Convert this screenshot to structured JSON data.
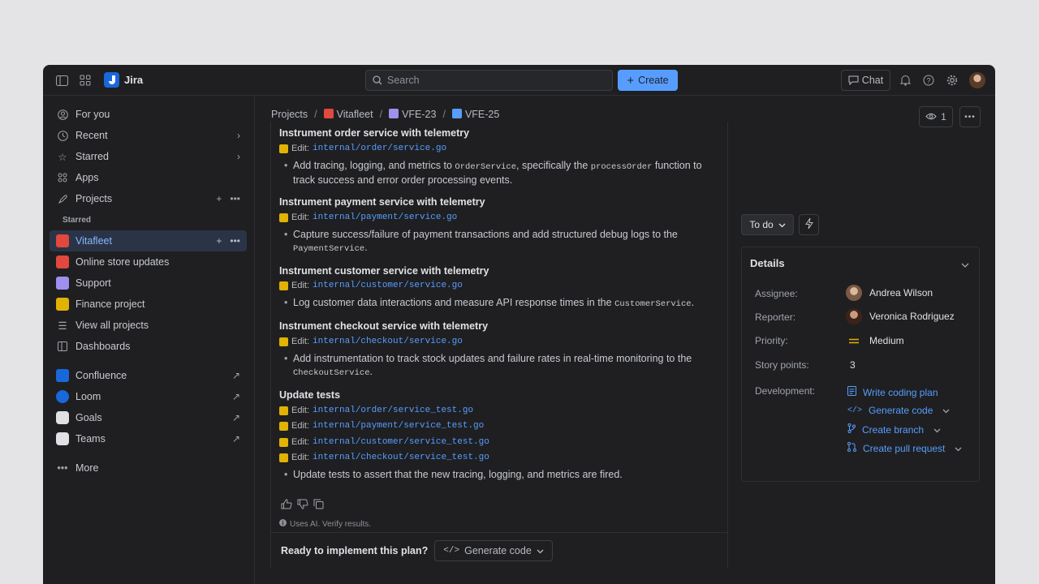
{
  "topbar": {
    "app_name": "Jira",
    "search_placeholder": "Search",
    "create_label": "Create",
    "chat_label": "Chat"
  },
  "sidebar": {
    "for_you": "For you",
    "recent": "Recent",
    "starred": "Starred",
    "apps": "Apps",
    "projects": "Projects",
    "starred_section": "Starred",
    "projects_list": [
      {
        "label": "Vitafleet",
        "color": "#e2483d"
      },
      {
        "label": "Online store updates",
        "color": "#e2483d"
      },
      {
        "label": "Support",
        "color": "#9f8fef"
      },
      {
        "label": "Finance project",
        "color": "#e2b203"
      }
    ],
    "view_all": "View all projects",
    "dashboards": "Dashboards",
    "external": [
      {
        "label": "Confluence"
      },
      {
        "label": "Loom"
      },
      {
        "label": "Goals"
      },
      {
        "label": "Teams"
      }
    ],
    "more": "More"
  },
  "breadcrumb": {
    "projects": "Projects",
    "project": "Vitafleet",
    "epic": "VFE-23",
    "issue": "VFE-25"
  },
  "plan": {
    "sections": [
      {
        "title": "Instrument order service with telemetry",
        "edits": [
          "internal/order/service.go"
        ],
        "bullet_pre": "Add tracing, logging, and metrics to ",
        "bullet_code": "OrderService",
        "bullet_mid": ", specifically the ",
        "bullet_code2": "processOrder",
        "bullet_post": " function to track success and error order processing events."
      },
      {
        "title": "Instrument payment service with telemetry",
        "edits": [
          "internal/payment/service.go"
        ],
        "bullet_pre": "Capture success/failure of payment transactions and add structured debug logs to the ",
        "bullet_code": "PaymentService",
        "bullet_post": "."
      },
      {
        "title": "Instrument customer service with telemetry",
        "edits": [
          "internal/customer/service.go"
        ],
        "bullet_pre": "Log customer data interactions and measure API response times in the ",
        "bullet_code": "CustomerService",
        "bullet_post": "."
      },
      {
        "title": "Instrument checkout service with telemetry",
        "edits": [
          "internal/checkout/service.go"
        ],
        "bullet_pre": "Add instrumentation to track stock updates and failure rates in real-time monitoring to the ",
        "bullet_code": "CheckoutService",
        "bullet_post": "."
      },
      {
        "title": "Update tests",
        "edits": [
          "internal/order/service_test.go",
          "internal/payment/service_test.go",
          "internal/customer/service_test.go",
          "internal/checkout/service_test.go"
        ],
        "bullet_pre": "Update tests to assert that the new tracing, logging, and metrics are fired."
      }
    ],
    "edit_prefix": "Edit:",
    "disclaimer": "Uses AI. Verify results.",
    "ready_question": "Ready to implement this plan?",
    "generate_code": "Generate code"
  },
  "issue_panel": {
    "watchers": "1",
    "status": "To do",
    "details_title": "Details",
    "assignee_label": "Assignee:",
    "assignee": "Andrea Wilson",
    "reporter_label": "Reporter:",
    "reporter": "Veronica Rodriguez",
    "priority_label": "Priority:",
    "priority": "Medium",
    "priority_color": "#e2b203",
    "story_points_label": "Story points:",
    "story_points": "3",
    "development_label": "Development:",
    "dev_actions": [
      "Write coding plan",
      "Generate code",
      "Create branch",
      "Create pull request"
    ]
  }
}
